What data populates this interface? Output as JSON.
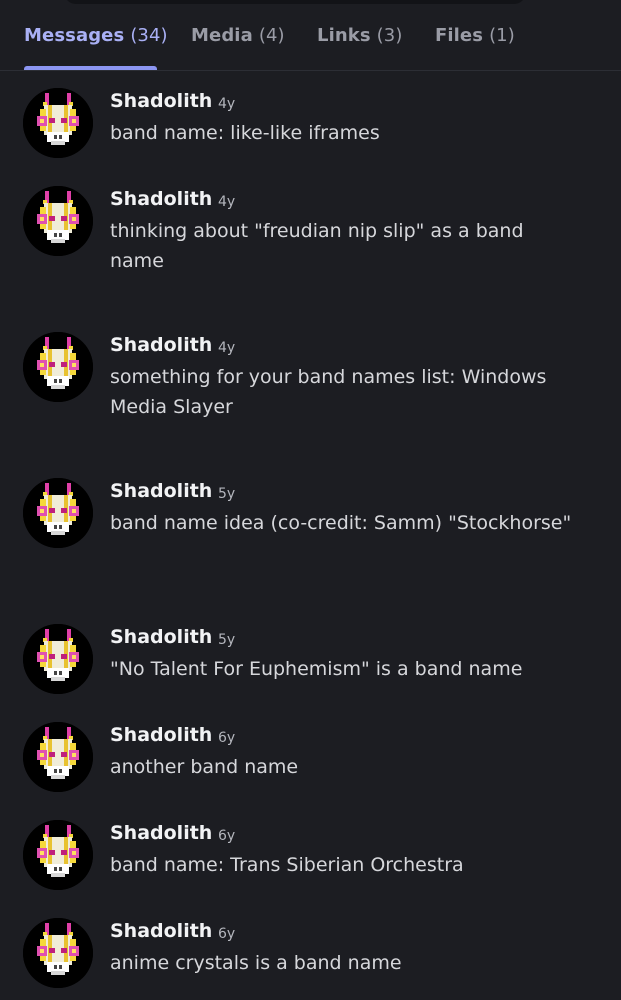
{
  "tabs": [
    {
      "label": "Messages",
      "count": "(34)",
      "active": true
    },
    {
      "label": "Media",
      "count": "(4)",
      "active": false
    },
    {
      "label": "Links",
      "count": "(3)",
      "active": false
    },
    {
      "label": "Files",
      "count": "(1)",
      "active": false
    }
  ],
  "colors": {
    "background": "#1c1d22",
    "active_tab": "#a9b0f5",
    "inactive_tab": "#9a9ca6",
    "accent_underline": "#8c96f2"
  },
  "messages": [
    {
      "author": "Shadolith",
      "time": "4y",
      "text": "band name: like-like iframes"
    },
    {
      "author": "Shadolith",
      "time": "4y",
      "text": "thinking about \"freudian nip slip\" as a band name"
    },
    {
      "author": "Shadolith",
      "time": "4y",
      "text": "something for your band names list: Windows Media Slayer"
    },
    {
      "author": "Shadolith",
      "time": "5y",
      "text": "band name idea (co-credit: Samm) \"Stockhorse\""
    },
    {
      "author": "Shadolith",
      "time": "5y",
      "text": "\"No Talent For Euphemism\" is a band name"
    },
    {
      "author": "Shadolith",
      "time": "6y",
      "text": "another band name"
    },
    {
      "author": "Shadolith",
      "time": "6y",
      "text": "band name: Trans Siberian Orchestra"
    },
    {
      "author": "Shadolith",
      "time": "6y",
      "text": "anime crystals is a band name"
    }
  ],
  "avatar_icon": "pixel-mask-avatar-icon"
}
